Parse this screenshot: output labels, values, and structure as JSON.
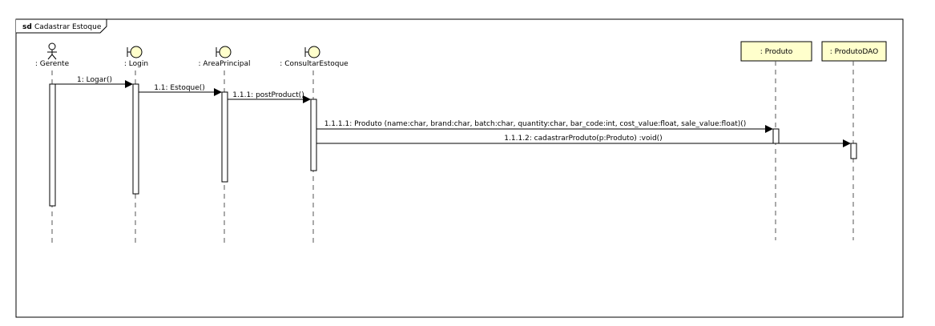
{
  "frame": {
    "keyword": "sd",
    "title": "Cadastrar Estoque"
  },
  "lifelines": [
    {
      "id": "gerente",
      "label": ": Gerente",
      "kind": "actor-icon"
    },
    {
      "id": "login",
      "label": ": Login",
      "kind": "boundary-icon"
    },
    {
      "id": "area",
      "label": ": AreaPrincipal",
      "kind": "boundary-icon"
    },
    {
      "id": "consultar",
      "label": ": ConsultarEstoque",
      "kind": "boundary-icon"
    },
    {
      "id": "produto",
      "label": ": Produto",
      "kind": "object-box"
    },
    {
      "id": "produtodao",
      "label": ": ProdutoDAO",
      "kind": "object-box"
    }
  ],
  "messages": [
    {
      "id": "m1",
      "label": "1: Logar()",
      "from": "gerente",
      "to": "login"
    },
    {
      "id": "m2",
      "label": "1.1: Estoque()",
      "from": "login",
      "to": "area"
    },
    {
      "id": "m3",
      "label": "1.1.1: postProduct()",
      "from": "area",
      "to": "consultar"
    },
    {
      "id": "m4",
      "label": "1.1.1.1: Produto (name:char, brand:char, batch:char, quantity:char, bar_code:int, cost_value:float, sale_value:float)()",
      "from": "consultar",
      "to": "produto"
    },
    {
      "id": "m5",
      "label": "1.1.1.2: cadastrarProduto(p:Produto) :void()",
      "from": "consultar",
      "to": "produtodao"
    }
  ],
  "colors": {
    "object_fill": "#ffffcc",
    "icon_fill": "#ffffcc",
    "line": "#000000",
    "lifeline_dash": "#555555"
  }
}
